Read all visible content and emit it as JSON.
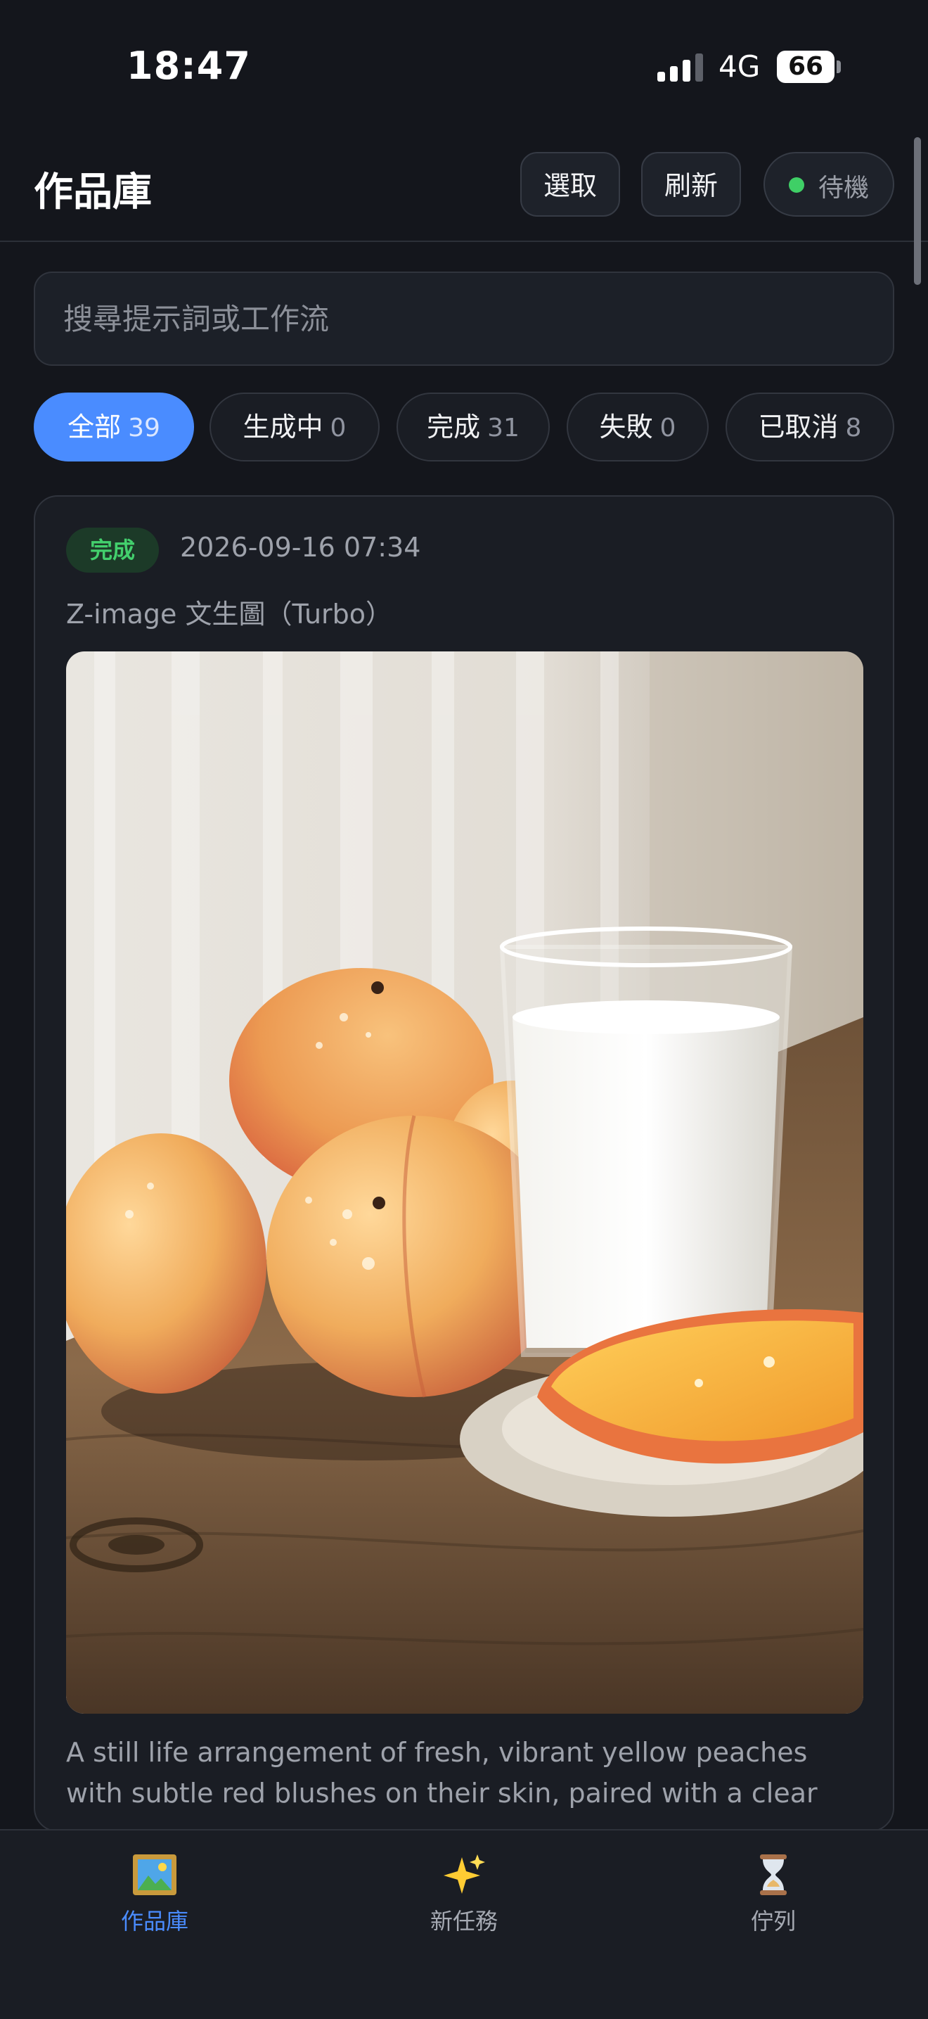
{
  "status_bar": {
    "time": "18:47",
    "network": "4G",
    "battery": "66"
  },
  "header": {
    "title": "作品庫",
    "select_label": "選取",
    "refresh_label": "刷新",
    "status_label": "待機"
  },
  "search": {
    "placeholder": "搜尋提示詞或工作流"
  },
  "filters": [
    {
      "label": "全部",
      "count": "39"
    },
    {
      "label": "生成中",
      "count": "0"
    },
    {
      "label": "完成",
      "count": "31"
    },
    {
      "label": "失敗",
      "count": "0"
    },
    {
      "label": "已取消",
      "count": "8"
    }
  ],
  "card": {
    "status": "完成",
    "date": "2026-09-16 07:34",
    "workflow": "Z-image 文生圖（Turbo）",
    "prompt": "A still life arrangement of fresh, vibrant yellow peaches with subtle red blushes on their skin, paired with a clear glass of..."
  },
  "tabs": [
    {
      "label": "作品庫",
      "icon": "framed-picture-icon"
    },
    {
      "label": "新任務",
      "icon": "sparkles-icon"
    },
    {
      "label": "佇列",
      "icon": "hourglass-icon"
    }
  ]
}
